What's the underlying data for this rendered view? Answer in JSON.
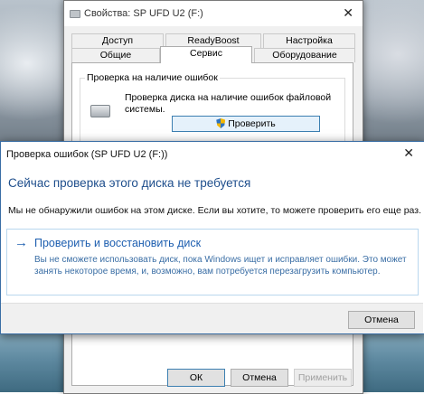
{
  "properties_window": {
    "title": "Свойства: SP UFD U2 (F:)",
    "close_glyph": "✕",
    "tabs_row1": [
      "Доступ",
      "ReadyBoost",
      "Настройка"
    ],
    "tabs_row2": [
      "Общие",
      "Сервис",
      "Оборудование"
    ],
    "active_tab": "Сервис",
    "group_label": "Проверка на наличие ошибок",
    "check_description": "Проверка диска на наличие ошибок файловой системы.",
    "check_button": "Проверить",
    "ok_button": "ОК",
    "cancel_button": "Отмена",
    "apply_button": "Применить"
  },
  "error_check_dialog": {
    "title": "Проверка ошибок (SP UFD U2 (F:))",
    "close_glyph": "✕",
    "heading": "Сейчас проверка этого диска не требуется",
    "message": "Мы не обнаружили ошибок на этом диске. Если вы хотите, то можете проверить его еще раз.",
    "action_title": "Проверить и восстановить диск",
    "action_description": "Вы не сможете использовать диск, пока Windows ищет и исправляет ошибки. Это может занять некоторое время, и, возможно, вам потребуется перезагрузить компьютер.",
    "action_arrow": "→",
    "cancel_button": "Отмена"
  },
  "colors": {
    "accent_blue": "#1e5fb0",
    "heading_blue": "#1e4e8c",
    "dialog_border": "#3a6ea5"
  }
}
